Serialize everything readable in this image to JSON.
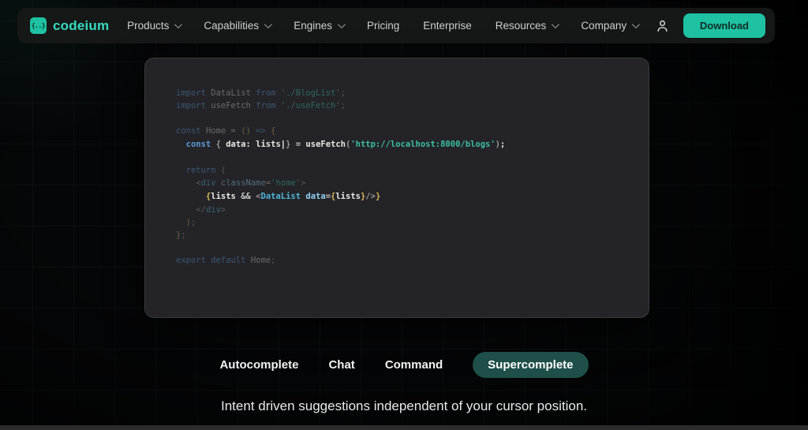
{
  "colors": {
    "accent": "#1ec2a3",
    "logo_text": "#35dcc0",
    "active_pill": "#1e4f49",
    "panel_bg": "#242428"
  },
  "brand": {
    "name": "codeium",
    "logo_glyph": "{..}"
  },
  "nav": {
    "items": [
      {
        "label": "Products",
        "chevron": true
      },
      {
        "label": "Capabilities",
        "chevron": true
      },
      {
        "label": "Engines",
        "chevron": true
      },
      {
        "label": "Pricing",
        "chevron": false
      },
      {
        "label": "Enterprise",
        "chevron": false
      },
      {
        "label": "Resources",
        "chevron": true
      },
      {
        "label": "Company",
        "chevron": true
      }
    ],
    "download_label": "Download"
  },
  "code": {
    "lines": [
      {
        "dim": true,
        "tokens": [
          [
            "kw",
            "import "
          ],
          [
            "id",
            "DataList "
          ],
          [
            "kw",
            "from "
          ],
          [
            "str",
            "'./BlogList'"
          ],
          [
            "pun",
            ";"
          ]
        ]
      },
      {
        "dim": true,
        "tokens": [
          [
            "kw",
            "import "
          ],
          [
            "id",
            "useFetch "
          ],
          [
            "kw",
            "from "
          ],
          [
            "str",
            "'./useFetch'"
          ],
          [
            "pun",
            ";"
          ]
        ]
      },
      {
        "blank": true
      },
      {
        "dim": true,
        "tokens": [
          [
            "kw",
            "const "
          ],
          [
            "id",
            "Home "
          ],
          [
            "op",
            "= "
          ],
          [
            "yel",
            "() "
          ],
          [
            "kw",
            "=> "
          ],
          [
            "yel",
            "{"
          ]
        ]
      },
      {
        "bright": true,
        "tokens": [
          [
            "kw",
            "  const "
          ],
          [
            "pun",
            "{ "
          ],
          [
            "plain",
            "data: lists"
          ],
          [
            "cur",
            "|"
          ],
          [
            "pun",
            "} "
          ],
          [
            "op",
            "= "
          ],
          [
            "plain",
            "useFetch"
          ],
          [
            "pun",
            "("
          ],
          [
            "str",
            "'http://localhost:8000/blogs'"
          ],
          [
            "pun",
            ")"
          ],
          [
            "plain",
            ";"
          ]
        ]
      },
      {
        "blank": true
      },
      {
        "dim": true,
        "tokens": [
          [
            "kw",
            "  return "
          ],
          [
            "pun",
            "("
          ]
        ]
      },
      {
        "dim": true,
        "tokens": [
          [
            "pun",
            "    <"
          ],
          [
            "comp",
            "div "
          ],
          [
            "attr",
            "className"
          ],
          [
            "op",
            "="
          ],
          [
            "str",
            "'home'"
          ],
          [
            "pun",
            ">"
          ]
        ]
      },
      {
        "bright": true,
        "tokens": [
          [
            "yel",
            "      {"
          ],
          [
            "plain",
            "lists "
          ],
          [
            "op",
            "&& "
          ],
          [
            "pun",
            "<"
          ],
          [
            "comp",
            "DataList "
          ],
          [
            "attr",
            "data"
          ],
          [
            "op",
            "="
          ],
          [
            "yel",
            "{"
          ],
          [
            "plain",
            "lists"
          ],
          [
            "yel",
            "}"
          ],
          [
            "pun",
            "/>"
          ],
          [
            "yel",
            "}"
          ]
        ]
      },
      {
        "dim": true,
        "tokens": [
          [
            "pun",
            "    </"
          ],
          [
            "comp",
            "div"
          ],
          [
            "pun",
            ">"
          ]
        ]
      },
      {
        "dim": true,
        "tokens": [
          [
            "yel",
            "  )"
          ],
          [
            "pun",
            ";"
          ]
        ]
      },
      {
        "dim": true,
        "tokens": [
          [
            "yel",
            "}"
          ],
          [
            "pun",
            ";"
          ]
        ]
      },
      {
        "blank": true
      },
      {
        "dim": true,
        "tokens": [
          [
            "kw",
            "export default "
          ],
          [
            "id",
            "Home"
          ],
          [
            "pun",
            ";"
          ]
        ]
      }
    ]
  },
  "tabs": {
    "items": [
      {
        "label": "Autocomplete",
        "active": false
      },
      {
        "label": "Chat",
        "active": false
      },
      {
        "label": "Command",
        "active": false
      },
      {
        "label": "Supercomplete",
        "active": true
      }
    ]
  },
  "caption": "Intent driven suggestions independent of your cursor position."
}
